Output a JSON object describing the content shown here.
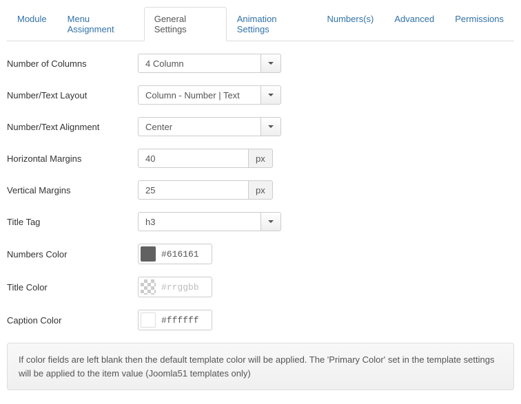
{
  "tabs": {
    "items": [
      {
        "label": "Module",
        "active": false
      },
      {
        "label": "Menu Assignment",
        "active": false
      },
      {
        "label": "General Settings",
        "active": true
      },
      {
        "label": "Animation Settings",
        "active": false
      },
      {
        "label": "Numbers(s)",
        "active": false
      },
      {
        "label": "Advanced",
        "active": false
      },
      {
        "label": "Permissions",
        "active": false
      }
    ]
  },
  "form": {
    "columns": {
      "label": "Number of Columns",
      "value": "4 Column"
    },
    "layout": {
      "label": "Number/Text Layout",
      "value": "Column - Number | Text"
    },
    "align": {
      "label": "Number/Text Alignment",
      "value": "Center"
    },
    "hmargin": {
      "label": "Horizontal Margins",
      "value": "40",
      "unit": "px"
    },
    "vmargin": {
      "label": "Vertical Margins",
      "value": "25",
      "unit": "px"
    },
    "titletag": {
      "label": "Title Tag",
      "value": "h3"
    },
    "numcolor": {
      "label": "Numbers Color",
      "value": "#616161",
      "swatch": "#616161"
    },
    "titlecolor": {
      "label": "Title Color",
      "value": "",
      "placeholder": "#rrggbb",
      "swatch": "transparent"
    },
    "captioncolor": {
      "label": "Caption Color",
      "value": "#ffffff",
      "swatch": "#ffffff"
    }
  },
  "notice": "If color fields are left blank then the default template color will be applied. The 'Primary Color' set in the template settings will be applied to the item value (Joomla51 templates only)"
}
